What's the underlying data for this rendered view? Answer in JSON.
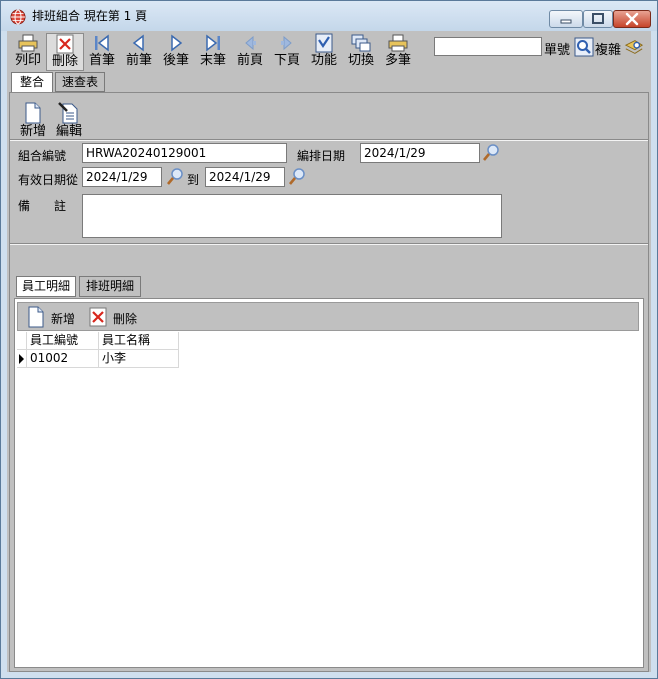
{
  "window": {
    "title": "排班組合  現在第 1 頁"
  },
  "toolbar": {
    "items": [
      {
        "label": "列印"
      },
      {
        "label": "刪除"
      },
      {
        "label": "首筆"
      },
      {
        "label": "前筆"
      },
      {
        "label": "後筆"
      },
      {
        "label": "末筆"
      },
      {
        "label": "前頁"
      },
      {
        "label": "下頁"
      },
      {
        "label": "功能"
      },
      {
        "label": "切換"
      },
      {
        "label": "多筆"
      }
    ],
    "lookup": {
      "value": "",
      "single_label": "單號",
      "complex_label": "複雜"
    }
  },
  "top_tabs": [
    {
      "label": "整合"
    },
    {
      "label": "速查表"
    }
  ],
  "form_toolbar": {
    "add_label": "新增",
    "edit_label": "編輯"
  },
  "form": {
    "combo_no_label": "組合編號",
    "combo_no_value": "HRWA20240129001",
    "schedule_date_label": "編排日期",
    "schedule_date_value": "2024/1/29",
    "valid_from_label": "有效日期從",
    "valid_from_value": "2024/1/29",
    "to_label": "到",
    "valid_to_value": "2024/1/29",
    "remark_label": "備　　註",
    "remark_value": ""
  },
  "detail_tabs": [
    {
      "label": "員工明細"
    },
    {
      "label": "排班明細"
    }
  ],
  "grid_toolbar": {
    "add_label": "新增",
    "delete_label": "刪除"
  },
  "grid": {
    "columns": [
      "員工編號",
      "員工名稱"
    ],
    "rows": [
      {
        "emp_no": "01002",
        "emp_name": "小李"
      }
    ]
  },
  "colors": {
    "window_frame": "#cfdfee",
    "face": "#c0c0c0",
    "close_button": "#c6442a",
    "accent_blue": "#2f5fb0"
  }
}
